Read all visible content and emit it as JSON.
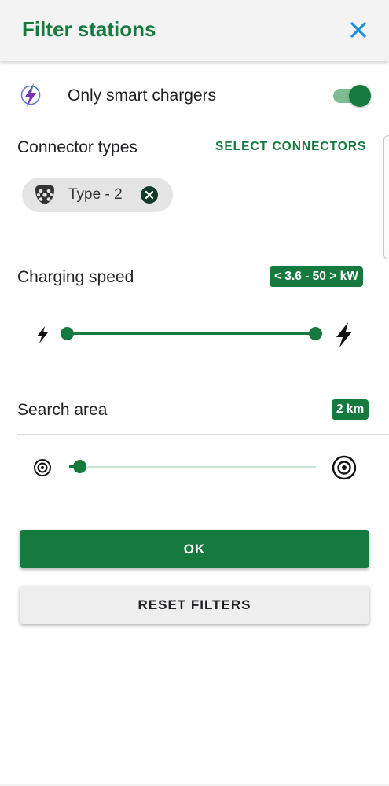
{
  "header": {
    "title": "Filter stations",
    "close_icon": "close-icon"
  },
  "smart": {
    "label": "Only smart chargers",
    "toggle_on": true,
    "icon": "smart-charger-bolt-icon"
  },
  "connectors": {
    "label": "Connector types",
    "select_label": "SELECT CONNECTORS",
    "chips": [
      {
        "label": "Type - 2",
        "icon": "type2-plug-icon",
        "remove_icon": "chip-remove-icon"
      }
    ]
  },
  "speed": {
    "label": "Charging speed",
    "badge": "< 3.6 - 50 > kW",
    "range": [
      3.6,
      50
    ],
    "min_icon": "bolt-small-icon",
    "max_icon": "bolt-large-icon"
  },
  "area": {
    "label": "Search area",
    "badge": "2 km",
    "value_km": 2,
    "min_icon": "target-small-icon",
    "max_icon": "target-large-icon"
  },
  "actions": {
    "ok": "OK",
    "reset": "RESET FILTERS"
  },
  "colors": {
    "accent": "#167a3e",
    "accent_light": "#7fbc93",
    "track_light": "#c9e3d1",
    "close": "#1a8fe0",
    "bolt_purple": "#7a2fbf"
  }
}
